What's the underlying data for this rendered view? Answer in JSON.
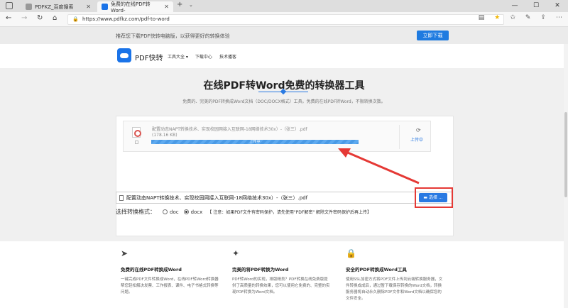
{
  "browser": {
    "tabs": [
      {
        "label": "PDFKZ_百度搜索",
        "color": "#888888"
      },
      {
        "label": "免费的在线PDF转Word-",
        "color": "#1a73e8"
      }
    ],
    "url": "https://www.pdfkz.com/pdf-to-word",
    "tab_close": "✕",
    "new_tab": "+",
    "dropdown": "⌄",
    "window_controls": [
      "—",
      "☐",
      "✕"
    ]
  },
  "promo": {
    "text": "推荐您下载PDF快转电脑版，以获得更好的转换体验",
    "button": "立即下载"
  },
  "site": {
    "logo": "PDF快转",
    "menu": [
      "工具大全 ▾",
      "下载中心",
      "技术播客"
    ]
  },
  "main": {
    "title": "在线PDF转Word免费的转换器工具",
    "subtitle": "免费的、完美的PDF转换成Word文档（DOC/DOCX格式）工具。免费的在线PDF转Word，不限转换次数。"
  },
  "file_card": {
    "name": "配置动态NAPT转换技术、实现校园网接入互联网-18网络技术30x）-（张三）.pdf",
    "size": "(178.16 KB)",
    "progress_label": "上传中",
    "progress_fraction": 1.0,
    "upload_label": "上传中"
  },
  "file_input": {
    "text": "配置动态NAPT转换技术、实现校园网接入互联网-18网络技术30x）-（张三）.pdf",
    "choose_button": "选择 ..."
  },
  "format": {
    "label": "选择转换格式：",
    "options": [
      "doc",
      "docx"
    ],
    "selected": "docx",
    "note": "【 注意：如果PDF文件有密码保护，请先使用\"PDF解密\" 解除文件密码保护后再上传】"
  },
  "features": [
    {
      "icon": "paper-plane-icon",
      "title": "免费的在线PDF转换成Word",
      "desc": "一键完成PDF文件转换成Word，在线PDF转Word转换器帮您轻松解决发票、工作报表、课件、电子书格式转换等问题。"
    },
    {
      "icon": "pdf-document-icon",
      "title": "完美的将PDF转换为Word",
      "desc": "PDF转Word的实现，排版精良？PDF转换在线免费版提供了高质量的转换效果，您可以使用它免费的、完整的实现PDF转换为Word文档。"
    },
    {
      "icon": "lock-icon",
      "title": "安全的PDF转换成Word工具",
      "desc": "使用SSL加密方式将PDF文件上传到云端转换服务器，文件转换成成后，通过暂下载保存转换的Word文档，转换服务器将自动永久删除PDF文件和Word文档以确保您的文件安全。"
    }
  ],
  "colors": {
    "accent": "#2a7ae2",
    "annotation": "#e53935"
  }
}
